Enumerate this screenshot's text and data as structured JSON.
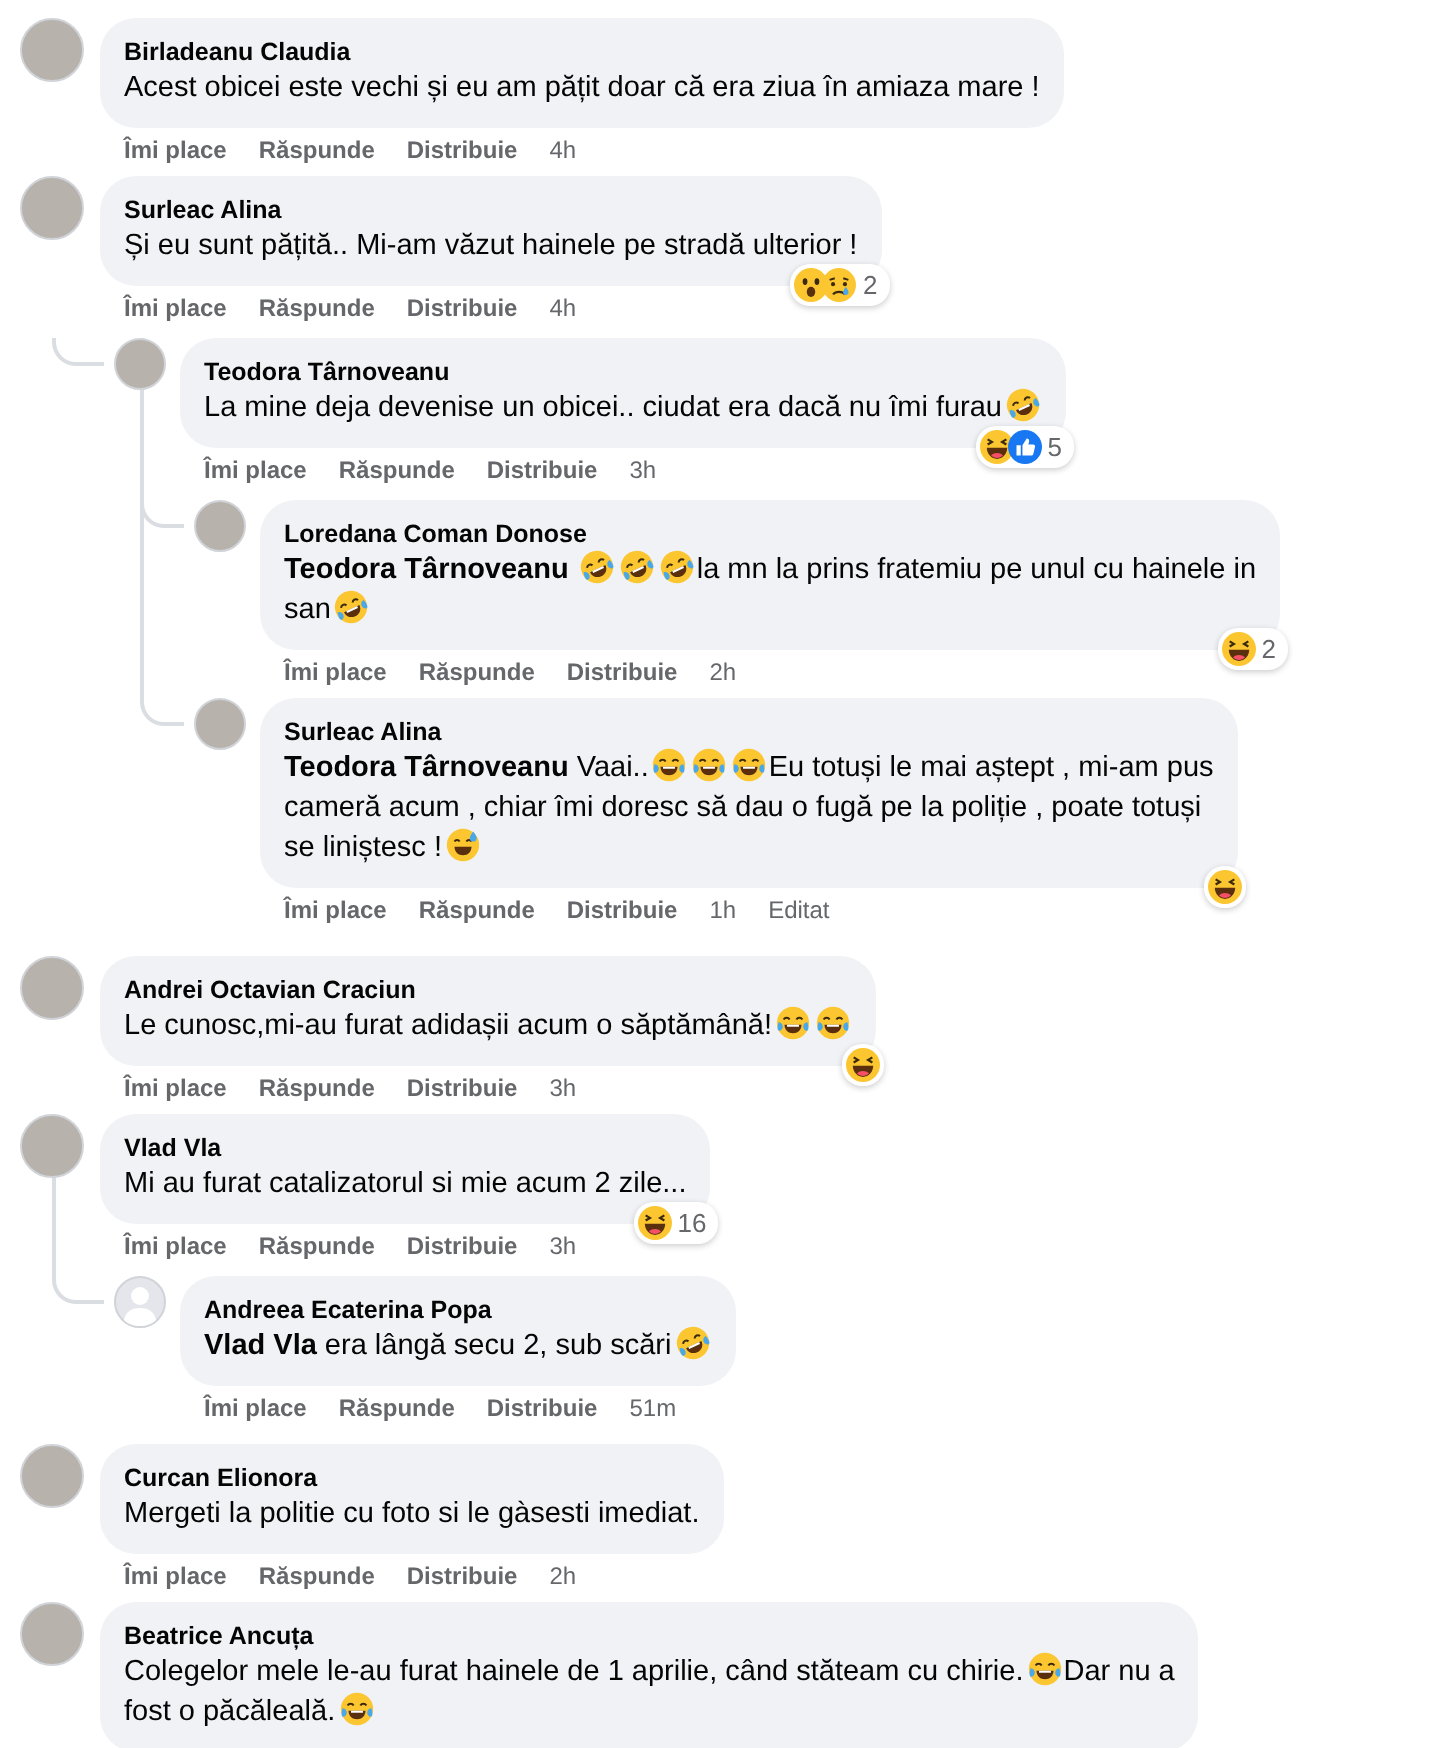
{
  "comments": [
    {
      "author": "Birladeanu Claudia",
      "avatar": {
        "kind": "photo"
      },
      "lines": [
        [
          {
            "kind": "text",
            "text": "Acest obicei este vechi și eu am pățit doar că era ziua în amiaza mare !"
          }
        ]
      ],
      "actions": [
        "Îmi place",
        "Răspunde",
        "Distribuie"
      ],
      "time": "4h"
    },
    {
      "author": "Surleac Alina",
      "avatar": {
        "kind": "photo"
      },
      "lines": [
        [
          {
            "kind": "text",
            "text": "Și eu sunt pățită.. Mi-am văzut hainele pe stradă ulterior !"
          }
        ]
      ],
      "reactions": {
        "icons": [
          {
            "kind": "wow"
          },
          {
            "kind": "sad"
          }
        ],
        "count": "2"
      },
      "actions": [
        "Îmi place",
        "Răspunde",
        "Distribuie"
      ],
      "time": "4h",
      "children": [
        {
          "author": "Teodora Târnoveanu",
          "avatar": {
            "kind": "photo"
          },
          "lines": [
            [
              {
                "kind": "text",
                "text": "La mine deja devenise un obicei.. ciudat era dacă nu îmi furau"
              },
              {
                "kind": "rofl"
              }
            ]
          ],
          "reactions": {
            "icons": [
              {
                "kind": "haha"
              },
              {
                "kind": "like"
              }
            ],
            "count": "5"
          },
          "actions": [
            "Îmi place",
            "Răspunde",
            "Distribuie"
          ],
          "time": "3h",
          "children": [
            {
              "author": "Loredana Coman Donose",
              "avatar": {
                "kind": "photo"
              },
              "lines": [
                [
                  {
                    "kind": "mention",
                    "text": "Teodora Târnoveanu"
                  },
                  {
                    "kind": "rofl"
                  },
                  {
                    "kind": "rofl"
                  },
                  {
                    "kind": "rofl"
                  },
                  {
                    "kind": "text",
                    "text": "la mn la prins fratemiu pe unul cu hainele in"
                  }
                ],
                [
                  {
                    "kind": "text",
                    "text": "san"
                  },
                  {
                    "kind": "rofl"
                  }
                ]
              ],
              "reactions": {
                "icons": [
                  {
                    "kind": "haha"
                  }
                ],
                "count": "2"
              },
              "actions": [
                "Îmi place",
                "Răspunde",
                "Distribuie"
              ],
              "time": "2h"
            },
            {
              "author": "Surleac Alina",
              "avatar": {
                "kind": "photo"
              },
              "lines": [
                [
                  {
                    "kind": "mention",
                    "text": "Teodora Târnoveanu"
                  },
                  {
                    "kind": "text",
                    "text": "Vaai.."
                  },
                  {
                    "kind": "joy"
                  },
                  {
                    "kind": "joy"
                  },
                  {
                    "kind": "joy"
                  },
                  {
                    "kind": "text",
                    "text": "Eu totuși le mai aștept , mi-am pus"
                  }
                ],
                [
                  {
                    "kind": "text",
                    "text": "cameră acum , chiar îmi doresc să dau o fugă pe la poliție , poate totuși"
                  }
                ],
                [
                  {
                    "kind": "text",
                    "text": "se liniștesc !"
                  },
                  {
                    "kind": "sweat"
                  }
                ]
              ],
              "reactions": {
                "icons": [
                  {
                    "kind": "haha"
                  }
                ]
              },
              "actions": [
                "Îmi place",
                "Răspunde",
                "Distribuie"
              ],
              "time": "1h",
              "edited": "Editat"
            }
          ]
        }
      ]
    },
    {
      "author": "Andrei Octavian Craciun",
      "avatar": {
        "kind": "photo"
      },
      "lines": [
        [
          {
            "kind": "text",
            "text": "Le cunosc,mi-au furat adidașii acum o săptămână!"
          },
          {
            "kind": "joy"
          },
          {
            "kind": "joy"
          }
        ]
      ],
      "reactions": {
        "icons": [
          {
            "kind": "haha"
          }
        ]
      },
      "actions": [
        "Îmi place",
        "Răspunde",
        "Distribuie"
      ],
      "time": "3h"
    },
    {
      "author": "Vlad Vla",
      "avatar": {
        "kind": "photo"
      },
      "lines": [
        [
          {
            "kind": "text",
            "text": "Mi au furat catalizatorul si mie acum 2 zile..."
          }
        ]
      ],
      "reactions": {
        "icons": [
          {
            "kind": "haha"
          }
        ],
        "count": "16"
      },
      "actions": [
        "Îmi place",
        "Răspunde",
        "Distribuie"
      ],
      "time": "3h",
      "children": [
        {
          "author": "Andreea Ecaterina Popa",
          "avatar": {
            "kind": "silhouette"
          },
          "lines": [
            [
              {
                "kind": "mention",
                "text": "Vlad Vla"
              },
              {
                "kind": "text",
                "text": "era lângă secu 2, sub scări"
              },
              {
                "kind": "rofl"
              }
            ]
          ],
          "actions": [
            "Îmi place",
            "Răspunde",
            "Distribuie"
          ],
          "time": "51m"
        }
      ]
    },
    {
      "author": "Curcan Elionora",
      "avatar": {
        "kind": "photo"
      },
      "lines": [
        [
          {
            "kind": "text",
            "text": "Mergeti la politie cu foto si le gàsesti imediat."
          }
        ]
      ],
      "actions": [
        "Îmi place",
        "Răspunde",
        "Distribuie"
      ],
      "time": "2h"
    },
    {
      "author": "Beatrice Ancuța",
      "avatar": {
        "kind": "photo"
      },
      "lines": [
        [
          {
            "kind": "text",
            "text": "Colegelor mele le-au furat hainele de 1 aprilie, când stăteam cu chirie."
          },
          {
            "kind": "joy"
          },
          {
            "kind": "text",
            "text": "Dar nu a"
          }
        ],
        [
          {
            "kind": "text",
            "text": "fost o păcăleală."
          },
          {
            "kind": "joy"
          }
        ]
      ]
    }
  ]
}
